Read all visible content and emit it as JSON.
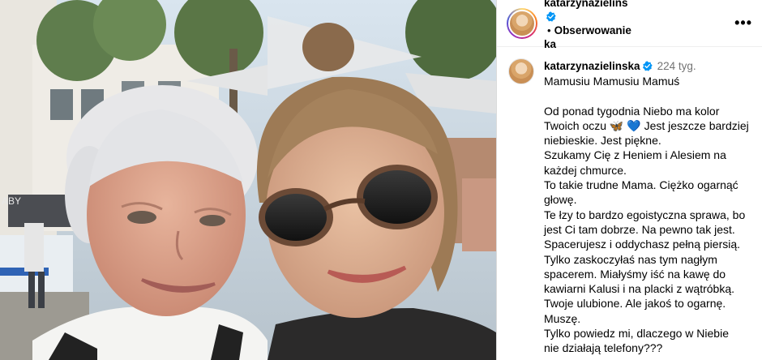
{
  "post": {
    "header": {
      "username_line1": "katarzynazielins",
      "username_line2": "ka",
      "follow_label": "Obserwowanie",
      "more_label": "•••"
    },
    "caption": {
      "username": "katarzynazielinska",
      "time": "224 tyg.",
      "title": "Mamusiu Mamusiu Mamuś",
      "lines": [
        "Od ponad tygodnia Niebo ma kolor",
        "Twoich oczu 🦋 💙 Jest jeszcze bardziej",
        "niebieskie. Jest piękne.",
        "Szukamy Cię z Heniem i Alesiem na",
        "każdej chmurce.",
        "To takie trudne Mama. Ciężko ogarnąć",
        "głowę.",
        "Te łzy to bardzo egoistyczna sprawa, bo",
        "jest Ci tam dobrze. Na pewno tak jest.",
        "Spacerujesz i oddychasz pełną piersią.",
        "Tylko zaskoczyłaś nas tym nagłym",
        "spacerem. Miałyśmy iść na kawę do",
        "kawiarni Kalusi i na placki z wątróbką.",
        "Twoje ulubione. Ale jakoś to ogarnę.",
        "Muszę.",
        "Tylko powiedz mi, dlaczego w Niebie",
        "nie działają telefony???"
      ]
    },
    "photo": {
      "sign_text": "ABY"
    }
  },
  "colors": {
    "verified": "#0095f6",
    "muted": "#737373"
  },
  "icons": [
    "verified-badge-icon",
    "more-options-icon"
  ]
}
